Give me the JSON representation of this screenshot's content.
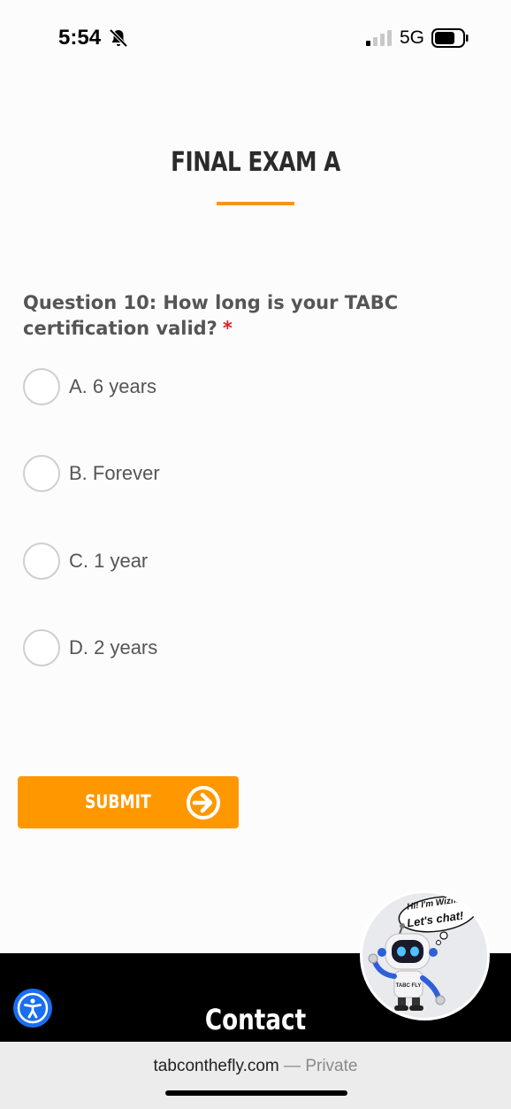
{
  "status_bar": {
    "time": "5:54",
    "network": "5G"
  },
  "page": {
    "title": "FINAL EXAM A"
  },
  "question": {
    "text": "Question 10: How long is your TABC certification valid?",
    "required_mark": "*"
  },
  "options": [
    {
      "label": "A. 6 years"
    },
    {
      "label": "B. Forever"
    },
    {
      "label": "C. 1 year"
    },
    {
      "label": "D. 2 years"
    }
  ],
  "submit": {
    "label": "SUBMIT"
  },
  "footer": {
    "contact": "Contact"
  },
  "chatbot": {
    "bubble_line1": "Hi! I'm Wizmo.",
    "bubble_line2": "Let's chat!",
    "badge": "TABC FLY"
  },
  "browser": {
    "domain": "tabconthefly.com",
    "privacy": " — Private"
  },
  "colors": {
    "accent": "#ff9800",
    "rule": "#f7941d",
    "required": "#e02020",
    "footer": "#000000",
    "accessibility": "#1a6ef0"
  },
  "icons": [
    "bell-slash-icon",
    "signal-icon",
    "battery-icon",
    "arrow-right-circle-icon",
    "accessibility-icon",
    "chatbot-robot-icon"
  ]
}
